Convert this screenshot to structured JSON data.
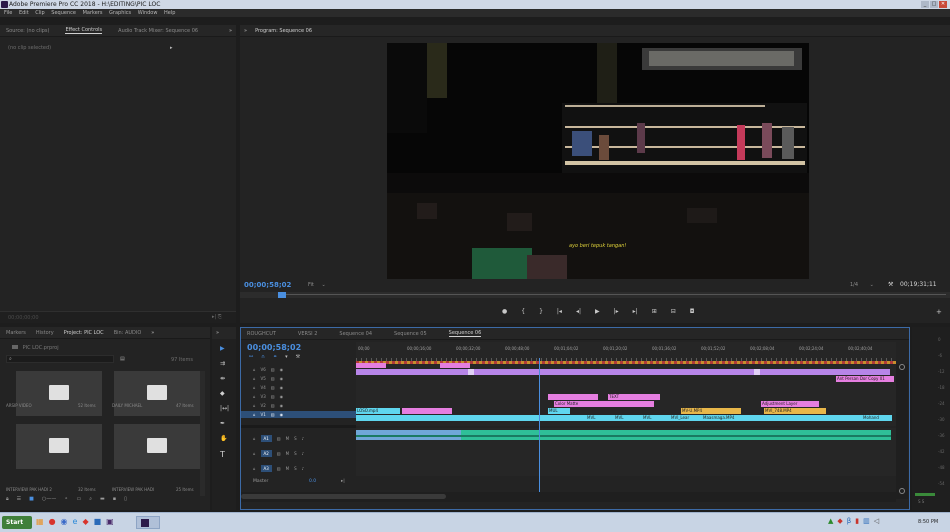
{
  "app": {
    "title": "Adobe Premiere Pro CC 2018 - H:\\EDITING\\PIC LOC",
    "window_buttons": [
      "_",
      "□",
      "✕"
    ]
  },
  "menu": [
    "File",
    "Edit",
    "Clip",
    "Sequence",
    "Markers",
    "Graphics",
    "Window",
    "Help"
  ],
  "source_panel": {
    "tabs": [
      "Source: (no clips)",
      "Effect Controls",
      "Audio Track Mixer: Sequence 06"
    ],
    "active_tab": "Effect Controls",
    "no_clip": "(no clip selected)",
    "timecode": "00;00;00;00"
  },
  "program_panel": {
    "tab": "Program: Sequence 06",
    "timecode": "00;00;58;02",
    "fit": "Fit",
    "quality": "1/4",
    "duration": "00;19;31;11",
    "subtitle": "ayo beri tepuk tangan!"
  },
  "project_panel": {
    "tabs": [
      "Markers",
      "History",
      "Project: PIC LOC",
      "Bin: AUDIO"
    ],
    "active_tab": "Project: PIC LOC",
    "file": "PIC LOC.prproj",
    "item_count": "97 Items",
    "bins": [
      {
        "name": "ARSIP VIDEO",
        "count": "52 Items"
      },
      {
        "name": "DAILY MICHAEL",
        "count": "47 Items"
      },
      {
        "name": "INTERVIEW PAK HADI 2",
        "count": "32 Items"
      },
      {
        "name": "INTERVIEW PAK HADI",
        "count": "25 Items"
      }
    ]
  },
  "timeline": {
    "tabs": [
      "ROUGHCUT",
      "VERSI 2",
      "Sequence 04",
      "Sequence 05",
      "Sequence 06"
    ],
    "active_tab": "Sequence 06",
    "timecode": "00;00;58;02",
    "ruler": [
      "00;00",
      "00;00;16;00",
      "00;00;32;00",
      "00;00;48;00",
      "00;01;04;02",
      "00;01;20;02",
      "00;01;36;02",
      "00;01;52;02",
      "00;02;08;04",
      "00;02;24;04",
      "00;02;40;04"
    ],
    "video_tracks": [
      "V6",
      "V5",
      "V4",
      "V3",
      "V2",
      "V1"
    ],
    "audio_tracks": [
      "A1",
      "A2",
      "A3"
    ],
    "master": "Master",
    "master_value": "0.0",
    "clips": {
      "pink": [
        "Color Matte",
        "TEXT",
        "MUL",
        "Adjustment Layer"
      ],
      "cyan": [
        "MVL",
        "MVL",
        "MVL",
        "MVI_Lear",
        "Maasmaga.MP4",
        "Mohand"
      ],
      "labels": [
        "LOSO.mp4",
        "Ant Persan Dor Copy 01",
        "MV-U.MP4",
        "MVI_748.MP4"
      ]
    }
  },
  "meters": [
    "0",
    "-6",
    "-12",
    "-18",
    "-24",
    "-30",
    "-36",
    "-42",
    "-48",
    "-54"
  ],
  "taskbar": {
    "start": "Start",
    "time": "8:50 PM"
  },
  "colors": {
    "accent": "#4a8fe0",
    "pink_clip": "#e57ee0",
    "violet_clip": "#b785e8",
    "cyan_clip": "#5fd6ee",
    "audio_clip": "#2fbf98"
  }
}
